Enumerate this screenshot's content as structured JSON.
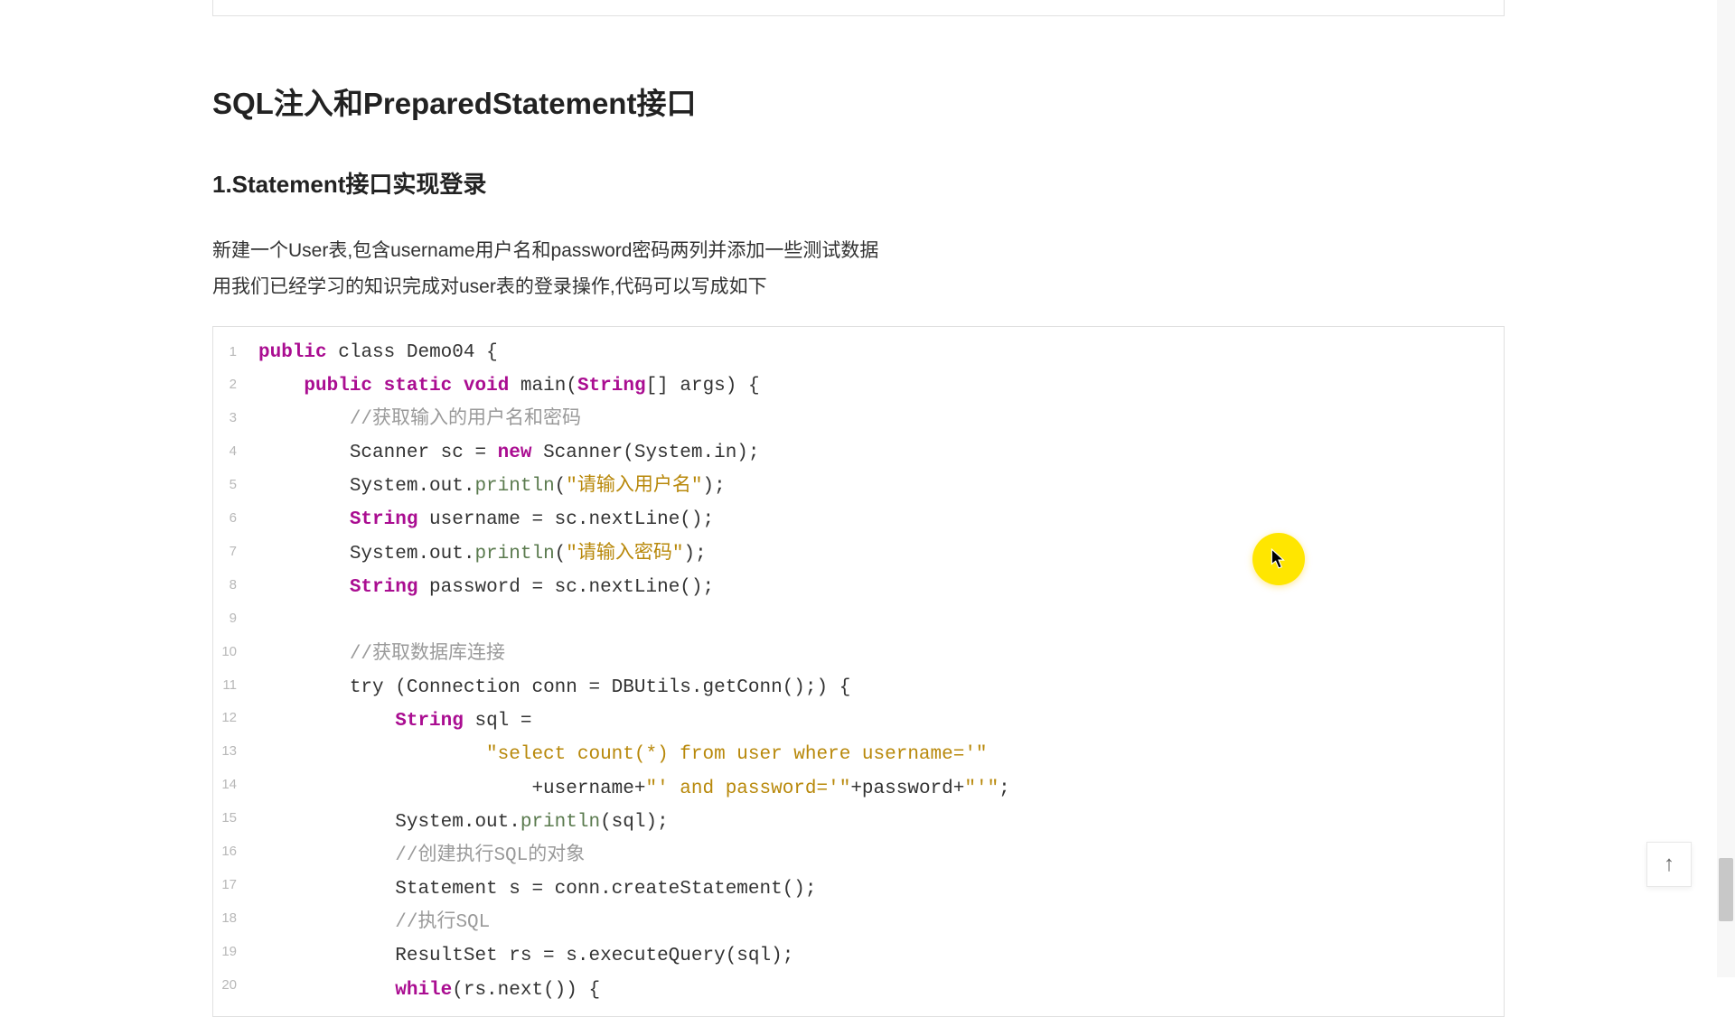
{
  "heading": "SQL注入和PreparedStatement接口",
  "subheading": "1.Statement接口实现登录",
  "para1": "新建一个User表,包含username用户名和password密码两列并添加一些测试数据",
  "para2": "用我们已经学习的知识完成对user表的登录操作,代码可以写成如下",
  "code": {
    "lines": [
      "1",
      "2",
      "3",
      "4",
      "5",
      "6",
      "7",
      "8",
      "9",
      "10",
      "11",
      "12",
      "13",
      "14",
      "15",
      "16",
      "17",
      "18",
      "19",
      "20"
    ],
    "l1": {
      "kw_public": "public",
      "kw_class": "class",
      "name": "Demo04",
      "brace": "{"
    },
    "l2": {
      "kw_public": "public",
      "kw_static": "static",
      "kw_void": "void",
      "main": "main(",
      "type_string": "String",
      "args": "[] args) {"
    },
    "l3": {
      "cmt": "//获取输入的用户名和密码"
    },
    "l4": {
      "a": "Scanner sc = ",
      "kw_new": "new",
      "b": " Scanner(System.in);"
    },
    "l5": {
      "a": "System.out.",
      "fn": "println",
      "b": "(",
      "str": "\"请输入用户名\"",
      "c": ");"
    },
    "l6": {
      "type": "String",
      "a": " username = sc.nextLine();"
    },
    "l7": {
      "a": "System.out.",
      "fn": "println",
      "b": "(",
      "str": "\"请输入密码\"",
      "c": ");"
    },
    "l8": {
      "type": "String",
      "a": " password = sc.nextLine();"
    },
    "l10": {
      "cmt": "//获取数据库连接"
    },
    "l11": {
      "a": "try (Connection conn = DBUtils.getConn();) {"
    },
    "l12": {
      "type": "String",
      "a": " sql ="
    },
    "l13": {
      "str": "\"select count(*) from user where username='\""
    },
    "l14": {
      "a": "+username+",
      "str1": "\"' and password='\"",
      "b": "+password+",
      "str2": "\"'\"",
      "c": ";"
    },
    "l15": {
      "a": "System.out.",
      "fn": "println",
      "b": "(sql);"
    },
    "l16": {
      "cmt": "//创建执行SQL的对象"
    },
    "l17": {
      "a": "Statement s = conn.createStatement();"
    },
    "l18": {
      "cmt": "//执行SQL"
    },
    "l19": {
      "a": "ResultSet rs = s.executeQuery(sql);"
    },
    "l20": {
      "kw": "while",
      "a": "(rs.next()) {"
    }
  },
  "scroll_top_icon": "↑"
}
